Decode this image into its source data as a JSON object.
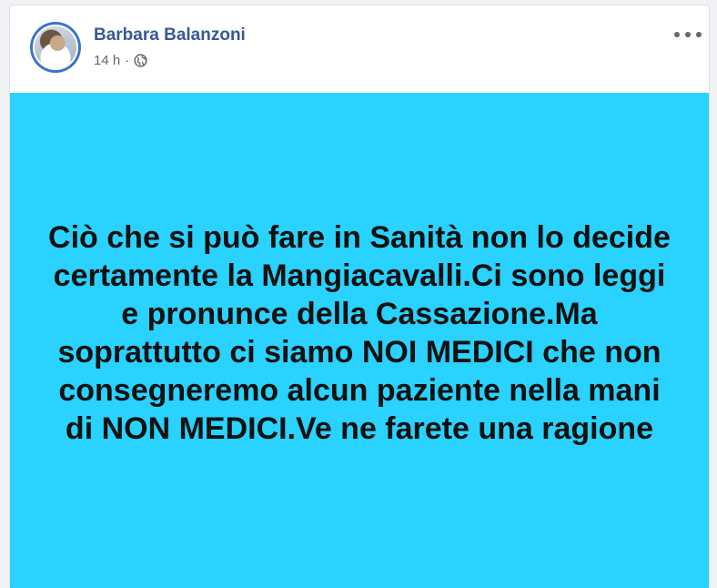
{
  "post": {
    "author_name": "Barbara Balanzoni",
    "timestamp": "14 h",
    "separator": "·",
    "audience_icon": "globe-icon",
    "more_icon": "more-options-icon",
    "text": "Ciò che si può fare in Sanità non lo decide certamente la Mangiacavalli.Ci sono leggi e pronunce della Cassazione.Ma soprattutto ci siamo NOI MEDICI che non consegneremo alcun paziente nella mani di NON MEDICI.Ve ne farete una ragione",
    "background_color": "#29d2ff",
    "author_color": "#385898"
  }
}
